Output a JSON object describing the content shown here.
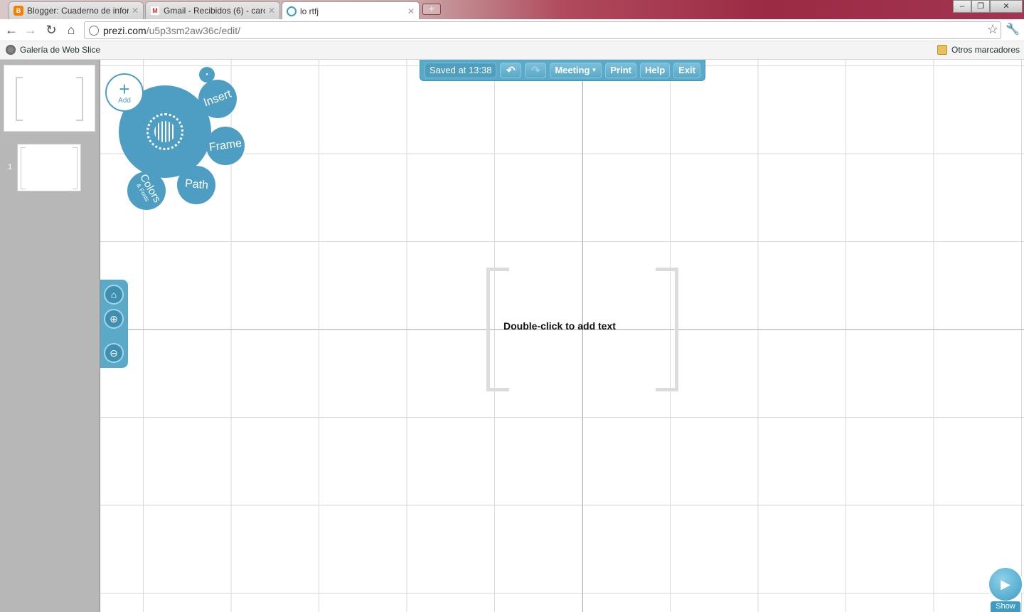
{
  "browser": {
    "tabs": [
      {
        "title": "Blogger: Cuaderno de infor",
        "favicon": "blogger-icon",
        "color": "#f57d00"
      },
      {
        "title": "Gmail - Recibidos (6) - caro",
        "favicon": "gmail-icon",
        "color": "#d93025"
      },
      {
        "title": "lo rtfj",
        "favicon": "prezi-icon",
        "color": "#3e9cc4"
      }
    ],
    "new_tab": "+",
    "window_buttons": [
      "–",
      "❐",
      "✕"
    ],
    "url_host": "prezi.com",
    "url_path": "/u5p3sm2aw36c/edit/",
    "bookmarks": [
      {
        "label": "Galería de Web Slice",
        "icon": "globe-icon"
      },
      {
        "label": "Otros marcadores",
        "icon": "folder-icon"
      }
    ]
  },
  "editor": {
    "toolbar": {
      "saved": "Saved at 13:38",
      "undo": "↶",
      "redo": "↷",
      "meeting": "Meeting",
      "print": "Print",
      "help": "Help",
      "exit": "Exit"
    },
    "bubble_menu": {
      "add": "Add",
      "insert": "Insert",
      "frame": "Frame",
      "path": "Path",
      "colors": "Colors",
      "colors_sub": "& Fonts"
    },
    "thumbnails": {
      "step_number": "1"
    },
    "canvas": {
      "placeholder": "Double-click to add text"
    },
    "show_label": "Show",
    "accent": "#4e9ec3"
  }
}
